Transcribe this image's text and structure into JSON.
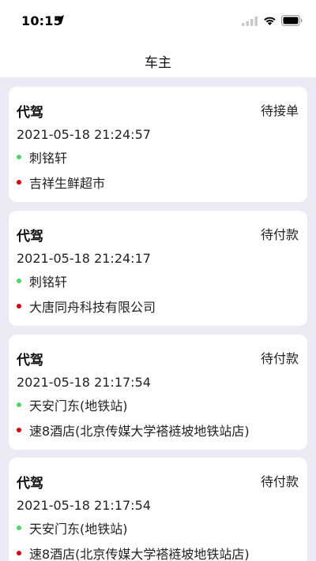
{
  "status_bar": {
    "time": "10:15"
  },
  "nav": {
    "title": "车主"
  },
  "colors": {
    "start_dot": "#4cd964",
    "end_dot": "#e0000a",
    "background": "#ecebf5"
  },
  "orders": [
    {
      "type": "代驾",
      "status": "待接单",
      "time": "2021-05-18 21:24:57",
      "start": "刺铭轩",
      "end": "吉祥生鲜超市"
    },
    {
      "type": "代驾",
      "status": "待付款",
      "time": "2021-05-18 21:24:17",
      "start": "刺铭轩",
      "end": "大唐同舟科技有限公司"
    },
    {
      "type": "代驾",
      "status": "待付款",
      "time": "2021-05-18 21:17:54",
      "start": "天安门东(地铁站)",
      "end": "速8酒店(北京传媒大学褡裢坡地铁站店)"
    },
    {
      "type": "代驾",
      "status": "待付款",
      "time": "2021-05-18 21:17:54",
      "start": "天安门东(地铁站)",
      "end": "速8酒店(北京传媒大学褡裢坡地铁站店)"
    }
  ]
}
